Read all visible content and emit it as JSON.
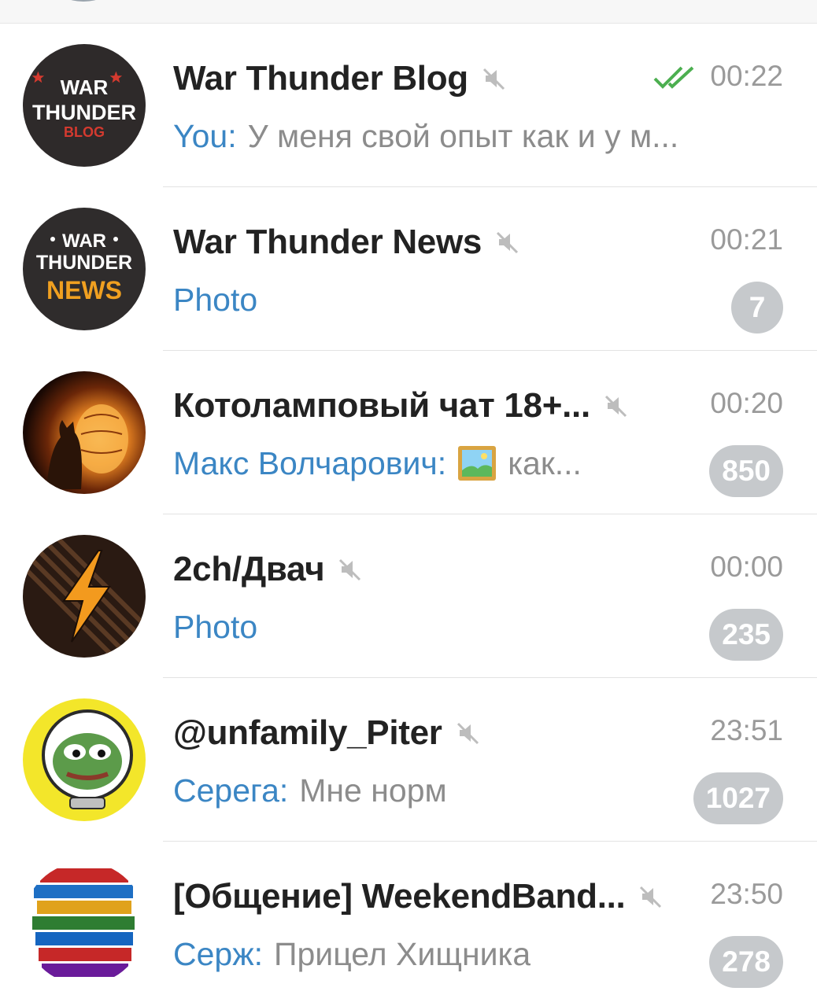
{
  "chats": [
    {
      "title": "War Thunder Blog",
      "time": "00:22",
      "sender": "You:",
      "message": "У меня свой опыт как и у м...",
      "muted": true,
      "read_status": "double-check-icon",
      "avatar": {
        "line1": "WAR",
        "line2": "THUNDER",
        "line3": "BLOG"
      }
    },
    {
      "title": "War Thunder News",
      "time": "00:21",
      "message": "Photo",
      "unread": "7",
      "muted": true,
      "avatar": {
        "line1": "WAR",
        "line2": "THUNDER",
        "line3": "NEWS"
      }
    },
    {
      "title": "Котоламповый чат 18+...",
      "time": "00:20",
      "sender": "Макс Волчарович:",
      "message": "как...",
      "unread": "850",
      "muted": true,
      "media_icon": "picture-icon"
    },
    {
      "title": "2ch/Двач",
      "time": "00:00",
      "message": "Photo",
      "unread": "235",
      "muted": true
    },
    {
      "title": "@unfamily_Piter",
      "time": "23:51",
      "sender": "Серега:",
      "message": "Мне норм",
      "unread": "1027",
      "muted": true
    },
    {
      "title": "[Общение] WeekendBand...",
      "time": "23:50",
      "sender": "Серж:",
      "message": "Прицел Хищника",
      "unread": "278",
      "muted": true
    }
  ],
  "colors": {
    "accent": "#3b86c4",
    "title": "#222222",
    "muted_text": "#8c8c8c",
    "badge_bg": "#c6c9cc",
    "check": "#4caf50"
  }
}
